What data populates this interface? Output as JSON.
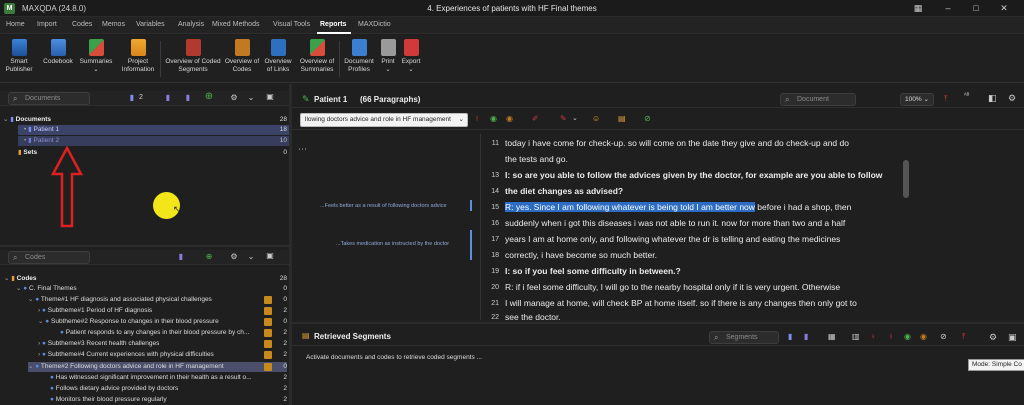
{
  "app": {
    "logo": "M",
    "name": "MAXQDA (24.8.0)",
    "document_title": "4. Experiences of patients with HF Final themes"
  },
  "menu": [
    "Home",
    "Import",
    "Codes",
    "Memos",
    "Variables",
    "Analysis",
    "Mixed Methods",
    "Visual Tools",
    "Reports",
    "MAXDictio"
  ],
  "active_menu": "Reports",
  "ribbon": [
    {
      "label": "Smart\nPublisher",
      "icon": "smart-publisher-icon"
    },
    {
      "label": "Codebook",
      "icon": "codebook-icon"
    },
    {
      "label": "Summaries\n⌄",
      "icon": "summaries-icon"
    },
    {
      "label": "Project\nInformation",
      "icon": "project-information-icon"
    },
    {
      "label": "Overview of Coded\nSegments",
      "icon": "overview-coded-segments-icon"
    },
    {
      "label": "Overview of\nCodes",
      "icon": "overview-codes-icon"
    },
    {
      "label": "Overview\nof Links",
      "icon": "overview-links-icon"
    },
    {
      "label": "Overview of\nSummaries",
      "icon": "overview-summaries-icon"
    },
    {
      "label": "Document\nProfiles",
      "icon": "document-profiles-icon"
    },
    {
      "label": "Print\n⌄",
      "icon": "print-icon"
    },
    {
      "label": "Export\n⌄",
      "icon": "export-icon"
    }
  ],
  "documents_panel": {
    "search_placeholder": "Documents",
    "count_badge": "2",
    "tree": [
      {
        "label": "Documents",
        "count": "28",
        "level": 0,
        "bold": true
      },
      {
        "label": "Patient 1",
        "count": "18",
        "level": 1
      },
      {
        "label": "Patient 2",
        "count": "10",
        "level": 1
      },
      {
        "label": "Sets",
        "count": "0",
        "level": 0,
        "bold": true
      }
    ]
  },
  "codes_panel": {
    "search_placeholder": "Codes",
    "tree": [
      {
        "label": "Codes",
        "count": "28",
        "level": 0,
        "bold": true
      },
      {
        "label": "C. Final Themes",
        "count": "0",
        "level": 1
      },
      {
        "label": "Theme#1 HF diagnosis and associated physical challenges",
        "count": "0",
        "level": 2
      },
      {
        "label": "Subtheme#1 Period of HF diagnosis",
        "count": "2",
        "level": 3
      },
      {
        "label": "Subtheme#2 Response to changes in their blood pressure",
        "count": "0",
        "level": 3
      },
      {
        "label": "Patient responds to any changes in their blood pressure by ch...",
        "count": "2",
        "level": 4
      },
      {
        "label": "Subtheme#3 Recent health challenges",
        "count": "2",
        "level": 3
      },
      {
        "label": "Subtheme#4 Current experiences with physical difficulties",
        "count": "2",
        "level": 3
      },
      {
        "label": "Theme#2 Following doctors advice and role in HF management",
        "count": "0",
        "level": 2
      },
      {
        "label": "Has witnessed significant improvement in their health as a result o...",
        "count": "2",
        "level": 3
      },
      {
        "label": "Follows dietary advice provided by doctors",
        "count": "2",
        "level": 3
      },
      {
        "label": "Monitors their blood pressure regularly",
        "count": "2",
        "level": 3
      }
    ]
  },
  "browser": {
    "title": "Patient 1",
    "paragraphs": "(66 Paragraphs)",
    "search_placeholder": "Document",
    "zoom": "100%",
    "code_dropdown": "llowing doctors advice and role in HF management",
    "memos": [
      "...Feels better as a result of following doctors advice",
      "...Takes medication as instructed by the doctor"
    ],
    "lines": [
      {
        "n": "11",
        "text": "today i have come for check-up. so will come on the date they give and do check-up and do",
        "bold": false
      },
      {
        "n": "",
        "text": "the tests and go.",
        "bold": false
      },
      {
        "n": "13",
        "text": "I: so are you able to follow the advices given by the doctor, for example are you able to follow",
        "bold": true
      },
      {
        "n": "14",
        "text": "the diet changes as advised?",
        "bold": true
      },
      {
        "n": "15",
        "sel": "R: yes. Since I am following whatever is being told I am better now",
        "text": " before i had a shop, then",
        "bold": false
      },
      {
        "n": "16",
        "text": "suddenly when i got this diseases i was not able to run it. now for more than two and a half",
        "bold": false
      },
      {
        "n": "17",
        "text": "years I am at home only, and following whatever the dr is telling and eating the medicines",
        "bold": false
      },
      {
        "n": "18",
        "text": "correctly, i have become so much better.",
        "bold": false
      },
      {
        "n": "19",
        "text": "I: so if you feel some difficulty in between.?",
        "bold": true
      },
      {
        "n": "20",
        "text": "R: if i feel some difficulty, I will go to the nearby hospital only if it is very urgent. Otherwise",
        "bold": false
      },
      {
        "n": "21",
        "text": "I will manage at home, will check BP at home itself. so if there is any changes then only got to",
        "bold": false
      },
      {
        "n": "22",
        "text": "see the doctor.",
        "bold": false
      }
    ]
  },
  "retrieved": {
    "title": "Retrieved Segments",
    "search_placeholder": "Segments",
    "message": "Activate documents and codes to retrieve coded segments ...",
    "mode": "Mode: Simple Co"
  },
  "colors": {
    "accent": "#2d6cc4",
    "highlight": "#4a4e6a",
    "arrow": "#e02020",
    "cursor": "#f2e61a"
  }
}
